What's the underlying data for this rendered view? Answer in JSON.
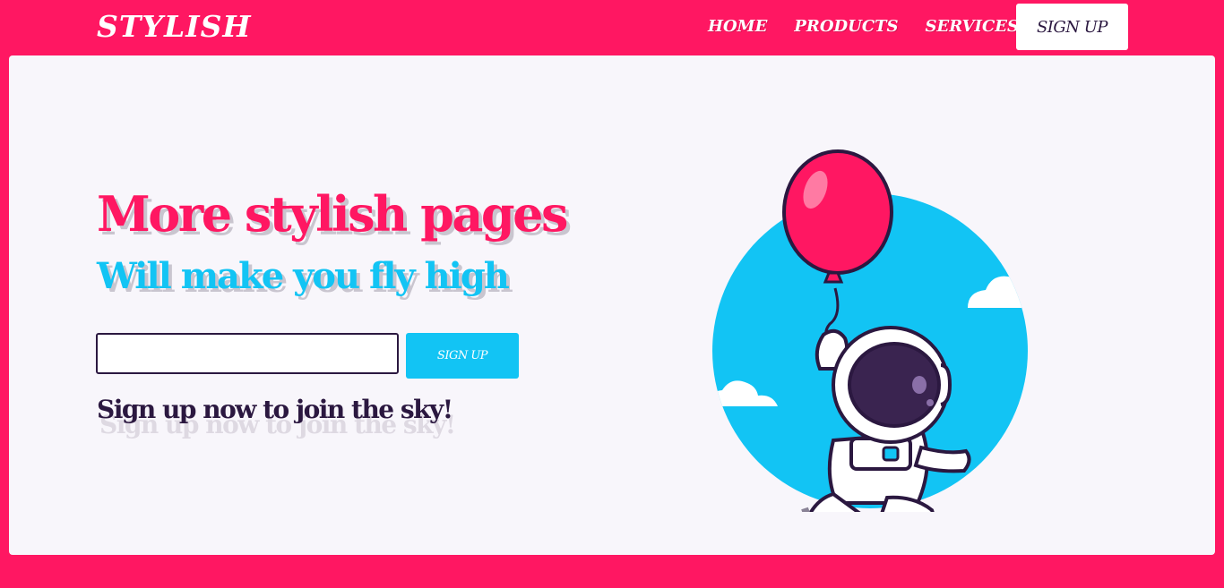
{
  "nav": {
    "logo": "STYLISH",
    "links": [
      "HOME",
      "PRODUCTS",
      "SERVICES"
    ],
    "signup_label": "SIGN UP"
  },
  "hero": {
    "headline": "More stylish pages",
    "subheadline": "Will make you fly high",
    "email_value": "",
    "signup_label": "SIGN UP",
    "tagline": "Sign up now to join the sky!"
  },
  "colors": {
    "brand_pink": "#ff1762",
    "accent_cyan": "#12c4f4",
    "dark_purple": "#2b1840",
    "panel_bg": "#f8f6fb"
  },
  "illustration": {
    "icons": [
      "balloon-icon",
      "astronaut-icon",
      "cloud-icon",
      "sky-circle"
    ]
  }
}
